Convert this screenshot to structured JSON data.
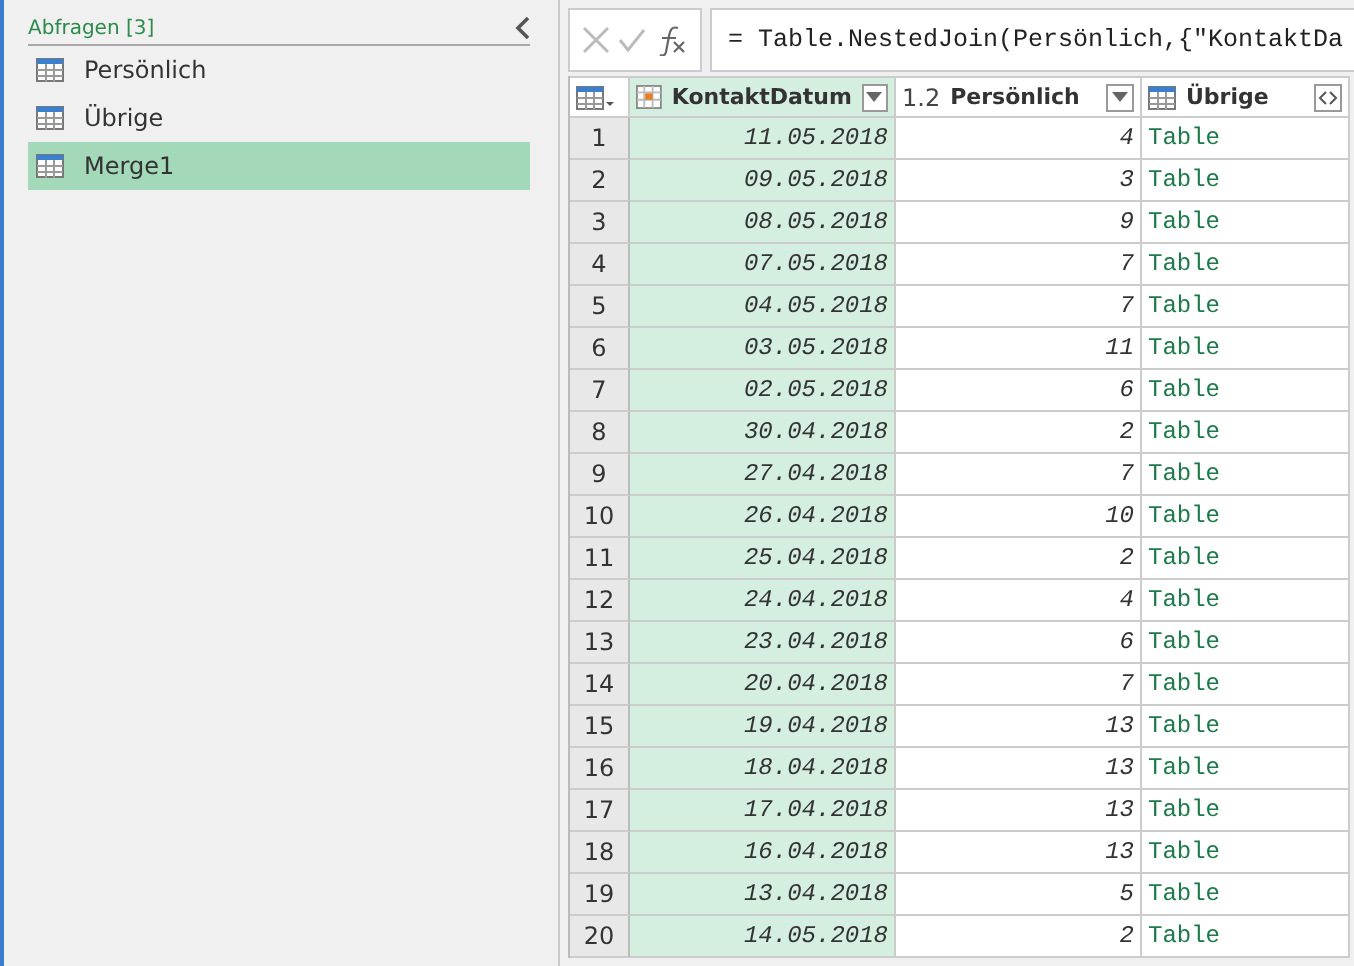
{
  "queries": {
    "title": "Abfragen [3]",
    "items": [
      {
        "label": "Persönlich",
        "selected": false
      },
      {
        "label": "Übrige",
        "selected": false
      },
      {
        "label": "Merge1",
        "selected": true
      }
    ]
  },
  "formula_bar": {
    "formula": "= Table.NestedJoin(Persönlich,{\"KontaktDa"
  },
  "table": {
    "columns": [
      {
        "kind": "date",
        "label": "KontaktDatum",
        "selected": true
      },
      {
        "kind": "number",
        "type_label": "1.2",
        "label": "Persönlich",
        "selected": false
      },
      {
        "kind": "table",
        "label": "Übrige",
        "selected": false
      }
    ],
    "rows": [
      {
        "index": "1",
        "cells": [
          "11.05.2018",
          "4",
          "Table"
        ]
      },
      {
        "index": "2",
        "cells": [
          "09.05.2018",
          "3",
          "Table"
        ]
      },
      {
        "index": "3",
        "cells": [
          "08.05.2018",
          "9",
          "Table"
        ]
      },
      {
        "index": "4",
        "cells": [
          "07.05.2018",
          "7",
          "Table"
        ]
      },
      {
        "index": "5",
        "cells": [
          "04.05.2018",
          "7",
          "Table"
        ]
      },
      {
        "index": "6",
        "cells": [
          "03.05.2018",
          "11",
          "Table"
        ]
      },
      {
        "index": "7",
        "cells": [
          "02.05.2018",
          "6",
          "Table"
        ]
      },
      {
        "index": "8",
        "cells": [
          "30.04.2018",
          "2",
          "Table"
        ]
      },
      {
        "index": "9",
        "cells": [
          "27.04.2018",
          "7",
          "Table"
        ]
      },
      {
        "index": "10",
        "cells": [
          "26.04.2018",
          "10",
          "Table"
        ]
      },
      {
        "index": "11",
        "cells": [
          "25.04.2018",
          "2",
          "Table"
        ]
      },
      {
        "index": "12",
        "cells": [
          "24.04.2018",
          "4",
          "Table"
        ]
      },
      {
        "index": "13",
        "cells": [
          "23.04.2018",
          "6",
          "Table"
        ]
      },
      {
        "index": "14",
        "cells": [
          "20.04.2018",
          "7",
          "Table"
        ]
      },
      {
        "index": "15",
        "cells": [
          "19.04.2018",
          "13",
          "Table"
        ]
      },
      {
        "index": "16",
        "cells": [
          "18.04.2018",
          "13",
          "Table"
        ]
      },
      {
        "index": "17",
        "cells": [
          "17.04.2018",
          "13",
          "Table"
        ]
      },
      {
        "index": "18",
        "cells": [
          "16.04.2018",
          "13",
          "Table"
        ]
      },
      {
        "index": "19",
        "cells": [
          "13.04.2018",
          "5",
          "Table"
        ]
      },
      {
        "index": "20",
        "cells": [
          "14.05.2018",
          "2",
          "Table"
        ]
      }
    ]
  }
}
